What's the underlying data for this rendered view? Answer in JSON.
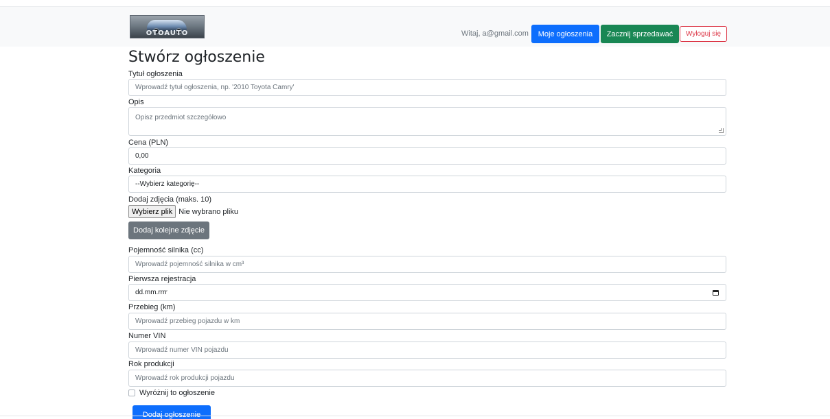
{
  "navbar": {
    "logo_text": "OTOAUTO",
    "greeting": "Witaj, a@gmail.com",
    "my_listings": "Moje ogłoszenia",
    "start_selling": "Zacznij sprzedawać",
    "logout": "Wyloguj się"
  },
  "form": {
    "title": "Stwórz ogłoszenie",
    "listing_title": {
      "label": "Tytuł ogłoszenia",
      "placeholder": "Wprowadź tytuł ogłoszenia, np. '2010 Toyota Camry'"
    },
    "description": {
      "label": "Opis",
      "placeholder": "Opisz przedmiot szczegółowo"
    },
    "price": {
      "label": "Cena (PLN)",
      "value": "0,00"
    },
    "category": {
      "label": "Kategoria",
      "selected": "--Wybierz kategorię--"
    },
    "photos": {
      "label": "Dodaj zdjęcia (maks. 10)",
      "choose_file": "Wybierz plik",
      "no_file": "Nie wybrano pliku",
      "add_more": "Dodaj kolejne zdjęcie"
    },
    "engine": {
      "label": "Pojemność silnika (cc)",
      "placeholder": "Wprowadź pojemność silnika w cm³"
    },
    "first_registration": {
      "label": "Pierwsza rejestracja",
      "value": "dd.mm.rrrr"
    },
    "mileage": {
      "label": "Przebieg (km)",
      "placeholder": "Wprowadź przebieg pojazdu w km"
    },
    "vin": {
      "label": "Numer VIN",
      "placeholder": "Wprowadź numer VIN pojazdu"
    },
    "year": {
      "label": "Rok produkcji",
      "placeholder": "Wprowadź rok produkcji pojazdu"
    },
    "featured": {
      "label": "Wyróżnij to ogłoszenie"
    },
    "submit": "Dodaj ogłoszenie"
  }
}
